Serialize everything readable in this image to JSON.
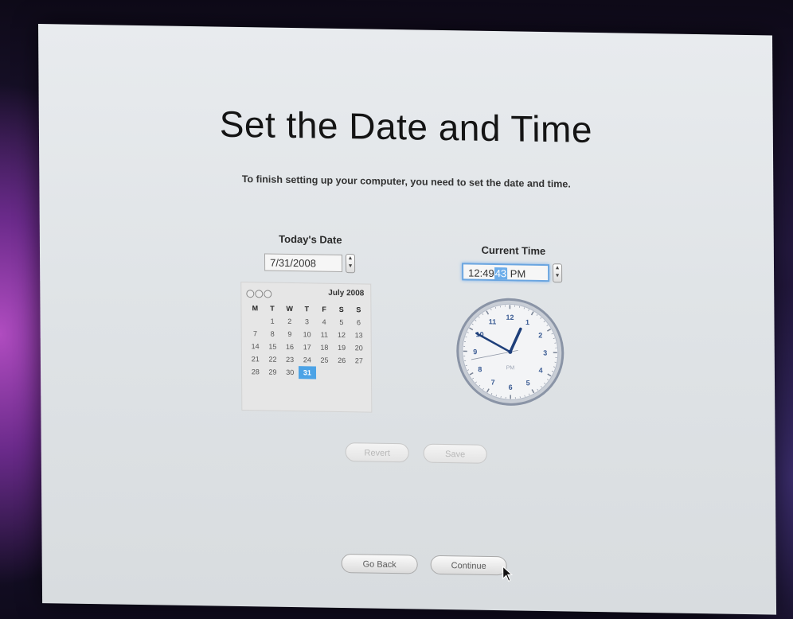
{
  "page": {
    "title": "Set the Date and Time",
    "subtitle": "To finish setting up your computer, you need to set the date and time."
  },
  "date": {
    "label": "Today's Date",
    "value": "7/31/2008"
  },
  "time": {
    "label": "Current Time",
    "hh_mm": "12:49",
    "seconds": "43",
    "ampm": "PM"
  },
  "calendar": {
    "month_title": "July 2008",
    "weekdays": [
      "M",
      "T",
      "W",
      "T",
      "F",
      "S",
      "S"
    ],
    "weeks": [
      [
        "",
        "1",
        "2",
        "3",
        "4",
        "5",
        "6"
      ],
      [
        "7",
        "8",
        "9",
        "10",
        "11",
        "12",
        "13"
      ],
      [
        "14",
        "15",
        "16",
        "17",
        "18",
        "19",
        "20"
      ],
      [
        "21",
        "22",
        "23",
        "24",
        "25",
        "26",
        "27"
      ],
      [
        "28",
        "29",
        "30",
        "31",
        "",
        "",
        ""
      ]
    ],
    "selected_day": "31"
  },
  "clock": {
    "hour": 12,
    "minute": 49,
    "second": 43,
    "pm_label": "PM",
    "numerals": [
      "12",
      "1",
      "2",
      "3",
      "4",
      "5",
      "6",
      "7",
      "8",
      "9",
      "10",
      "11"
    ]
  },
  "buttons": {
    "revert": "Revert",
    "save": "Save",
    "go_back": "Go Back",
    "continue": "Continue"
  },
  "colors": {
    "selection": "#4ca3e6",
    "focus_ring": "#6aa5e0",
    "clock_hand": "#1e3f7a"
  }
}
